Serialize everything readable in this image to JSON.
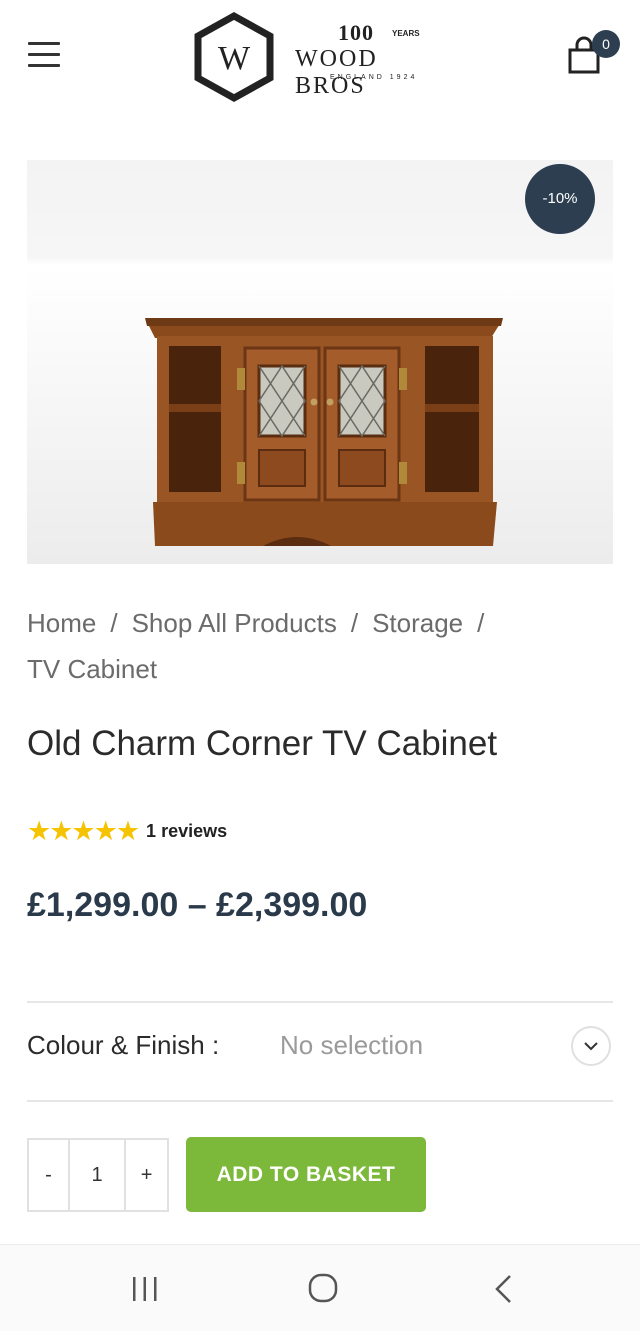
{
  "header": {
    "menu_icon": "hamburger-menu-icon",
    "logo": {
      "letter": "W",
      "hundred": "100",
      "years": "YEARS",
      "name": "WOOD BROS",
      "sub": "ENGLAND 1924"
    },
    "basket_icon": "shopping-bag-icon",
    "basket_count": "0"
  },
  "product": {
    "discount_badge": "-10%",
    "breadcrumb": [
      "Home",
      "Shop All Products",
      "Storage",
      "TV Cabinet"
    ],
    "breadcrumb_separator": "/",
    "title": "Old Charm Corner TV Cabinet",
    "rating": {
      "stars": 5,
      "max": 5,
      "review_count": "1",
      "review_label": "reviews"
    },
    "price": "£1,299.00 – £2,399.00",
    "variation": {
      "label": "Colour & Finish :",
      "value": "No selection"
    },
    "quantity": {
      "minus": "-",
      "value": "1",
      "plus": "+"
    },
    "add_to_basket": "ADD TO BASKET"
  },
  "colors": {
    "accent_green": "#7cb83a",
    "badge_navy": "#2c3e50",
    "star_gold": "#f6c300"
  },
  "system_nav": {
    "recent_icon": "recent-apps-icon",
    "home_icon": "home-circle-icon",
    "back_icon": "back-chevron-icon"
  }
}
